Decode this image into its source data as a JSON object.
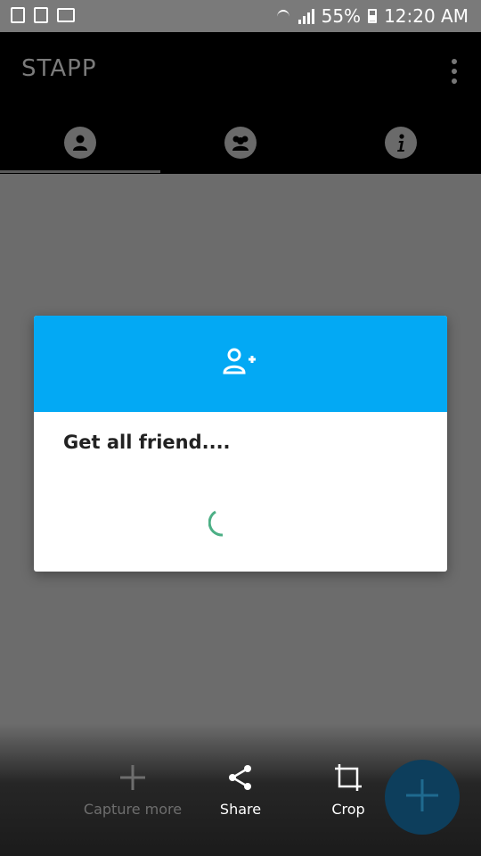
{
  "status_bar": {
    "battery": "55%",
    "time": "12:20 AM"
  },
  "app": {
    "title": "STAPP"
  },
  "tabs": [
    {
      "icon": "person-icon"
    },
    {
      "icon": "group-icon"
    },
    {
      "icon": "info-icon"
    }
  ],
  "dialog": {
    "header_icon": "add-friend-icon",
    "header_color": "#03a9f4",
    "message": "Get all friend....",
    "spinner_color": "#4caf85"
  },
  "bottom_actions": [
    {
      "label": "Capture more",
      "icon": "plus-icon",
      "enabled": false
    },
    {
      "label": "Share",
      "icon": "share-icon",
      "enabled": true
    },
    {
      "label": "Crop",
      "icon": "crop-icon",
      "enabled": true
    }
  ],
  "fab": {
    "icon": "plus-icon",
    "color": "#0d3e5c"
  }
}
